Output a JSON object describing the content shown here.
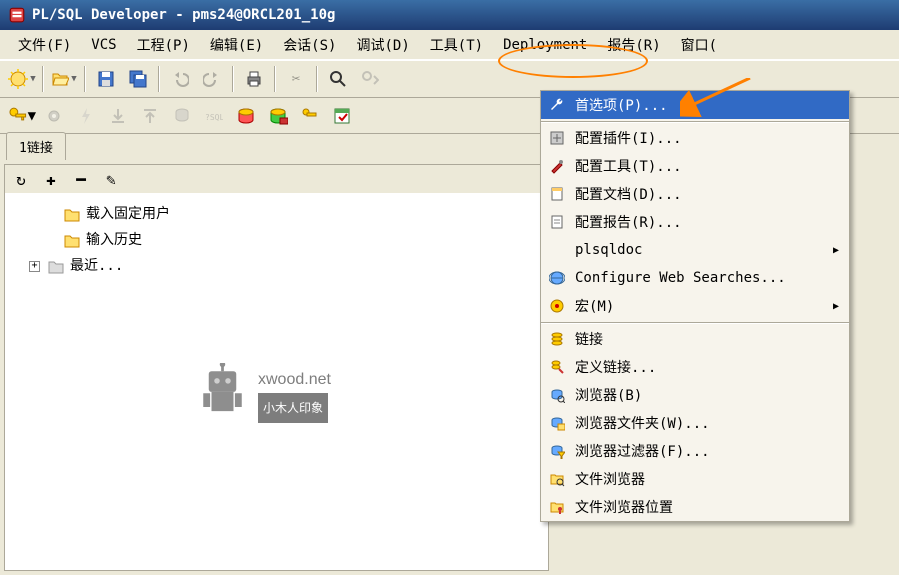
{
  "title": "PL/SQL Developer - pms24@ORCL201_10g",
  "menus": {
    "file": "文件(F)",
    "vcs": "VCS",
    "project": "工程(P)",
    "edit": "编辑(E)",
    "session": "会话(S)",
    "debug": "调试(D)",
    "tools": "工具(T)",
    "deploy": "Deployment",
    "report": "报告(R)",
    "window": "窗口("
  },
  "tabs": {
    "conn": "1链接"
  },
  "tree": {
    "item1": "载入固定用户",
    "item2": "输入历史",
    "item3": "最近..."
  },
  "watermark": {
    "url": "xwood.net",
    "sub": "小木人印象"
  },
  "dropdown": {
    "prefs": "首选项(P)...",
    "cfg_plugin": "配置插件(I)...",
    "cfg_tools": "配置工具(T)...",
    "cfg_docs": "配置文档(D)...",
    "cfg_reports": "配置报告(R)...",
    "plsqldoc": "plsqldoc",
    "web": "Configure Web Searches...",
    "macro": "宏(M)",
    "links": "链接",
    "def_links": "定义链接...",
    "browser": "浏览器(B)",
    "browser_folders": "浏览器文件夹(W)...",
    "browser_filters": "浏览器过滤器(F)...",
    "file_browser": "文件浏览器",
    "file_browser_loc": "文件浏览器位置"
  }
}
